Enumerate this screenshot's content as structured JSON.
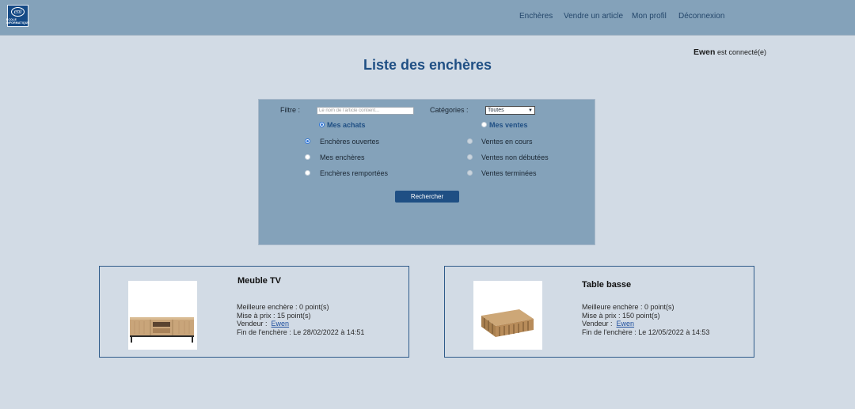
{
  "nav": {
    "logo_text": "eni",
    "logo_subtext": "ÉCOLE INFORMATIQUE",
    "links": [
      "Enchères",
      "Vendre un article",
      "Mon profil",
      "Déconnexion"
    ]
  },
  "user": {
    "name": "Ewen",
    "status_suffix": "est connecté(e)"
  },
  "page_title": "Liste des enchères",
  "filter": {
    "filter_label": "Filtre :",
    "search_placeholder": "Le nom de l'article contient...",
    "category_label": "Catégories :",
    "category_selected": "Toutes",
    "purchases_label": "Mes achats",
    "sales_label": "Mes ventes",
    "purchase_options": [
      "Enchères ouvertes",
      "Mes enchères",
      "Enchères remportées"
    ],
    "sale_options": [
      "Ventes en cours",
      "Ventes non débutées",
      "Ventes terminées"
    ],
    "search_button": "Rechercher"
  },
  "auctions": [
    {
      "title": "Meuble TV",
      "best_bid": "Meilleure enchère : 0 point(s)",
      "starting_price": "Mise à prix : 15 point(s)",
      "seller_label": "Vendeur :",
      "seller": "Ewen",
      "end_date": "Fin de l'enchère : Le 28/02/2022 à 14:51",
      "image_icon": "tv-stand-icon"
    },
    {
      "title": "Table basse",
      "best_bid": "Meilleure enchère : 0 point(s)",
      "starting_price": "Mise à prix : 150 point(s)",
      "seller_label": "Vendeur :",
      "seller": "Ewen",
      "end_date": "Fin de l'enchère : Le 12/05/2022 à 14:53",
      "image_icon": "coffee-table-icon"
    }
  ],
  "colors": {
    "background": "#d2dbe5",
    "navbar": "#84a2ba",
    "panel": "#84a2ba",
    "accent": "#1f4f84",
    "card_border": "#2f5b8a"
  }
}
